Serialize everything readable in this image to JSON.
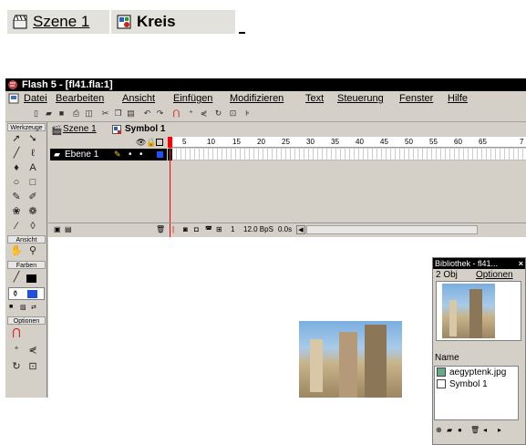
{
  "breadcrumb": {
    "scene_label": "Szene 1",
    "symbol_label": "Kreis"
  },
  "window": {
    "title": "Flash 5 - [fl41.fla:1]",
    "menu": [
      "Datei",
      "Bearbeiten",
      "Ansicht",
      "Einfügen",
      "Modifizieren",
      "Text",
      "Steuerung",
      "Fenster",
      "Hilfe"
    ]
  },
  "tools": {
    "header": "Werkzeuge",
    "section_view": "Ansicht",
    "section_colors": "Farben",
    "section_options": "Optionen"
  },
  "tabs": {
    "scene": "Szene 1",
    "symbol": "Symbol 1"
  },
  "timeline": {
    "layer_name": "Ebene 1",
    "frame_numbers": [
      "5",
      "10",
      "15",
      "20",
      "25",
      "30",
      "35",
      "40",
      "45",
      "50",
      "55",
      "60",
      "65",
      "7"
    ],
    "current_frame": "1",
    "frame_rate": "12.0 BpS",
    "elapsed": "0.0s"
  },
  "library": {
    "title": "Bibliothek - fl41...",
    "count": "2 Obj",
    "options": "Optionen",
    "name_header": "Name",
    "items": [
      "aegyptenk.jpg",
      "Symbol 1"
    ]
  },
  "colors": {
    "titlebar": "#000000",
    "chrome": "#d4d0c8",
    "playhead": "#ff0000",
    "selected_layer": "#000000"
  }
}
